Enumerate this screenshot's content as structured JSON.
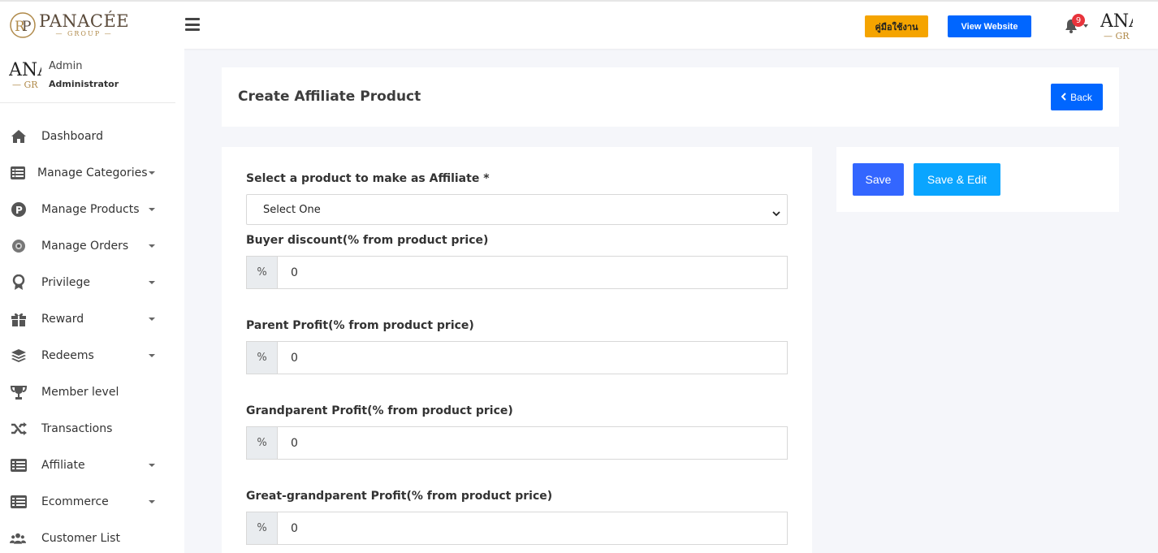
{
  "brand": {
    "name": "PANACÉE",
    "sub": "— GROUP —",
    "logo_icon": "rp-monogram-icon"
  },
  "topbar": {
    "manual_label": "คู่มือใช้งาน",
    "website_label": "View Website",
    "notification_count": "9",
    "avatar_text": "ANA",
    "avatar_sub": "— GR"
  },
  "user": {
    "name": "Admin",
    "role": "Administrator",
    "avatar_text": "ANA",
    "avatar_sub": "— GR"
  },
  "menu": [
    {
      "label": "Dashboard",
      "icon": "home-icon",
      "has_caret": false
    },
    {
      "label": "Manage Categories",
      "icon": "list-icon",
      "has_caret": true
    },
    {
      "label": "Manage Products",
      "icon": "product-p-icon",
      "has_caret": true
    },
    {
      "label": "Manage Orders",
      "icon": "orders-icon",
      "has_caret": true
    },
    {
      "label": "Privilege",
      "icon": "award-icon",
      "has_caret": true
    },
    {
      "label": "Reward",
      "icon": "gift-icon",
      "has_caret": true
    },
    {
      "label": "Redeems",
      "icon": "layers-icon",
      "has_caret": true
    },
    {
      "label": "Member level",
      "icon": "trophy-icon",
      "has_caret": false
    },
    {
      "label": "Transactions",
      "icon": "shuffle-icon",
      "has_caret": false
    },
    {
      "label": "Affiliate",
      "icon": "table-list-icon",
      "has_caret": true
    },
    {
      "label": "Ecommerce",
      "icon": "table-list-icon",
      "has_caret": true
    },
    {
      "label": "Customer List",
      "icon": "users-icon",
      "has_caret": false
    }
  ],
  "page": {
    "title": "Create Affiliate Product",
    "back_label": "Back"
  },
  "form": {
    "product_label": "Select a product to make as Affiliate *",
    "product_value": "Select One",
    "fields": [
      {
        "label": "Buyer discount(% from product price)",
        "addon": "%",
        "value": "0"
      },
      {
        "label": "Parent Profit(% from product price)",
        "addon": "%",
        "value": "0"
      },
      {
        "label": "Grandparent Profit(% from product price)",
        "addon": "%",
        "value": "0"
      },
      {
        "label": "Great-grandparent Profit(% from product price)",
        "addon": "%",
        "value": "0"
      }
    ]
  },
  "actions": {
    "save_label": "Save",
    "save_edit_label": "Save & Edit"
  },
  "colors": {
    "primary": "#0066ff",
    "save": "#3366ff",
    "save_edit": "#0aa5ff",
    "manual": "#f5a400",
    "badge": "#e8333b"
  }
}
